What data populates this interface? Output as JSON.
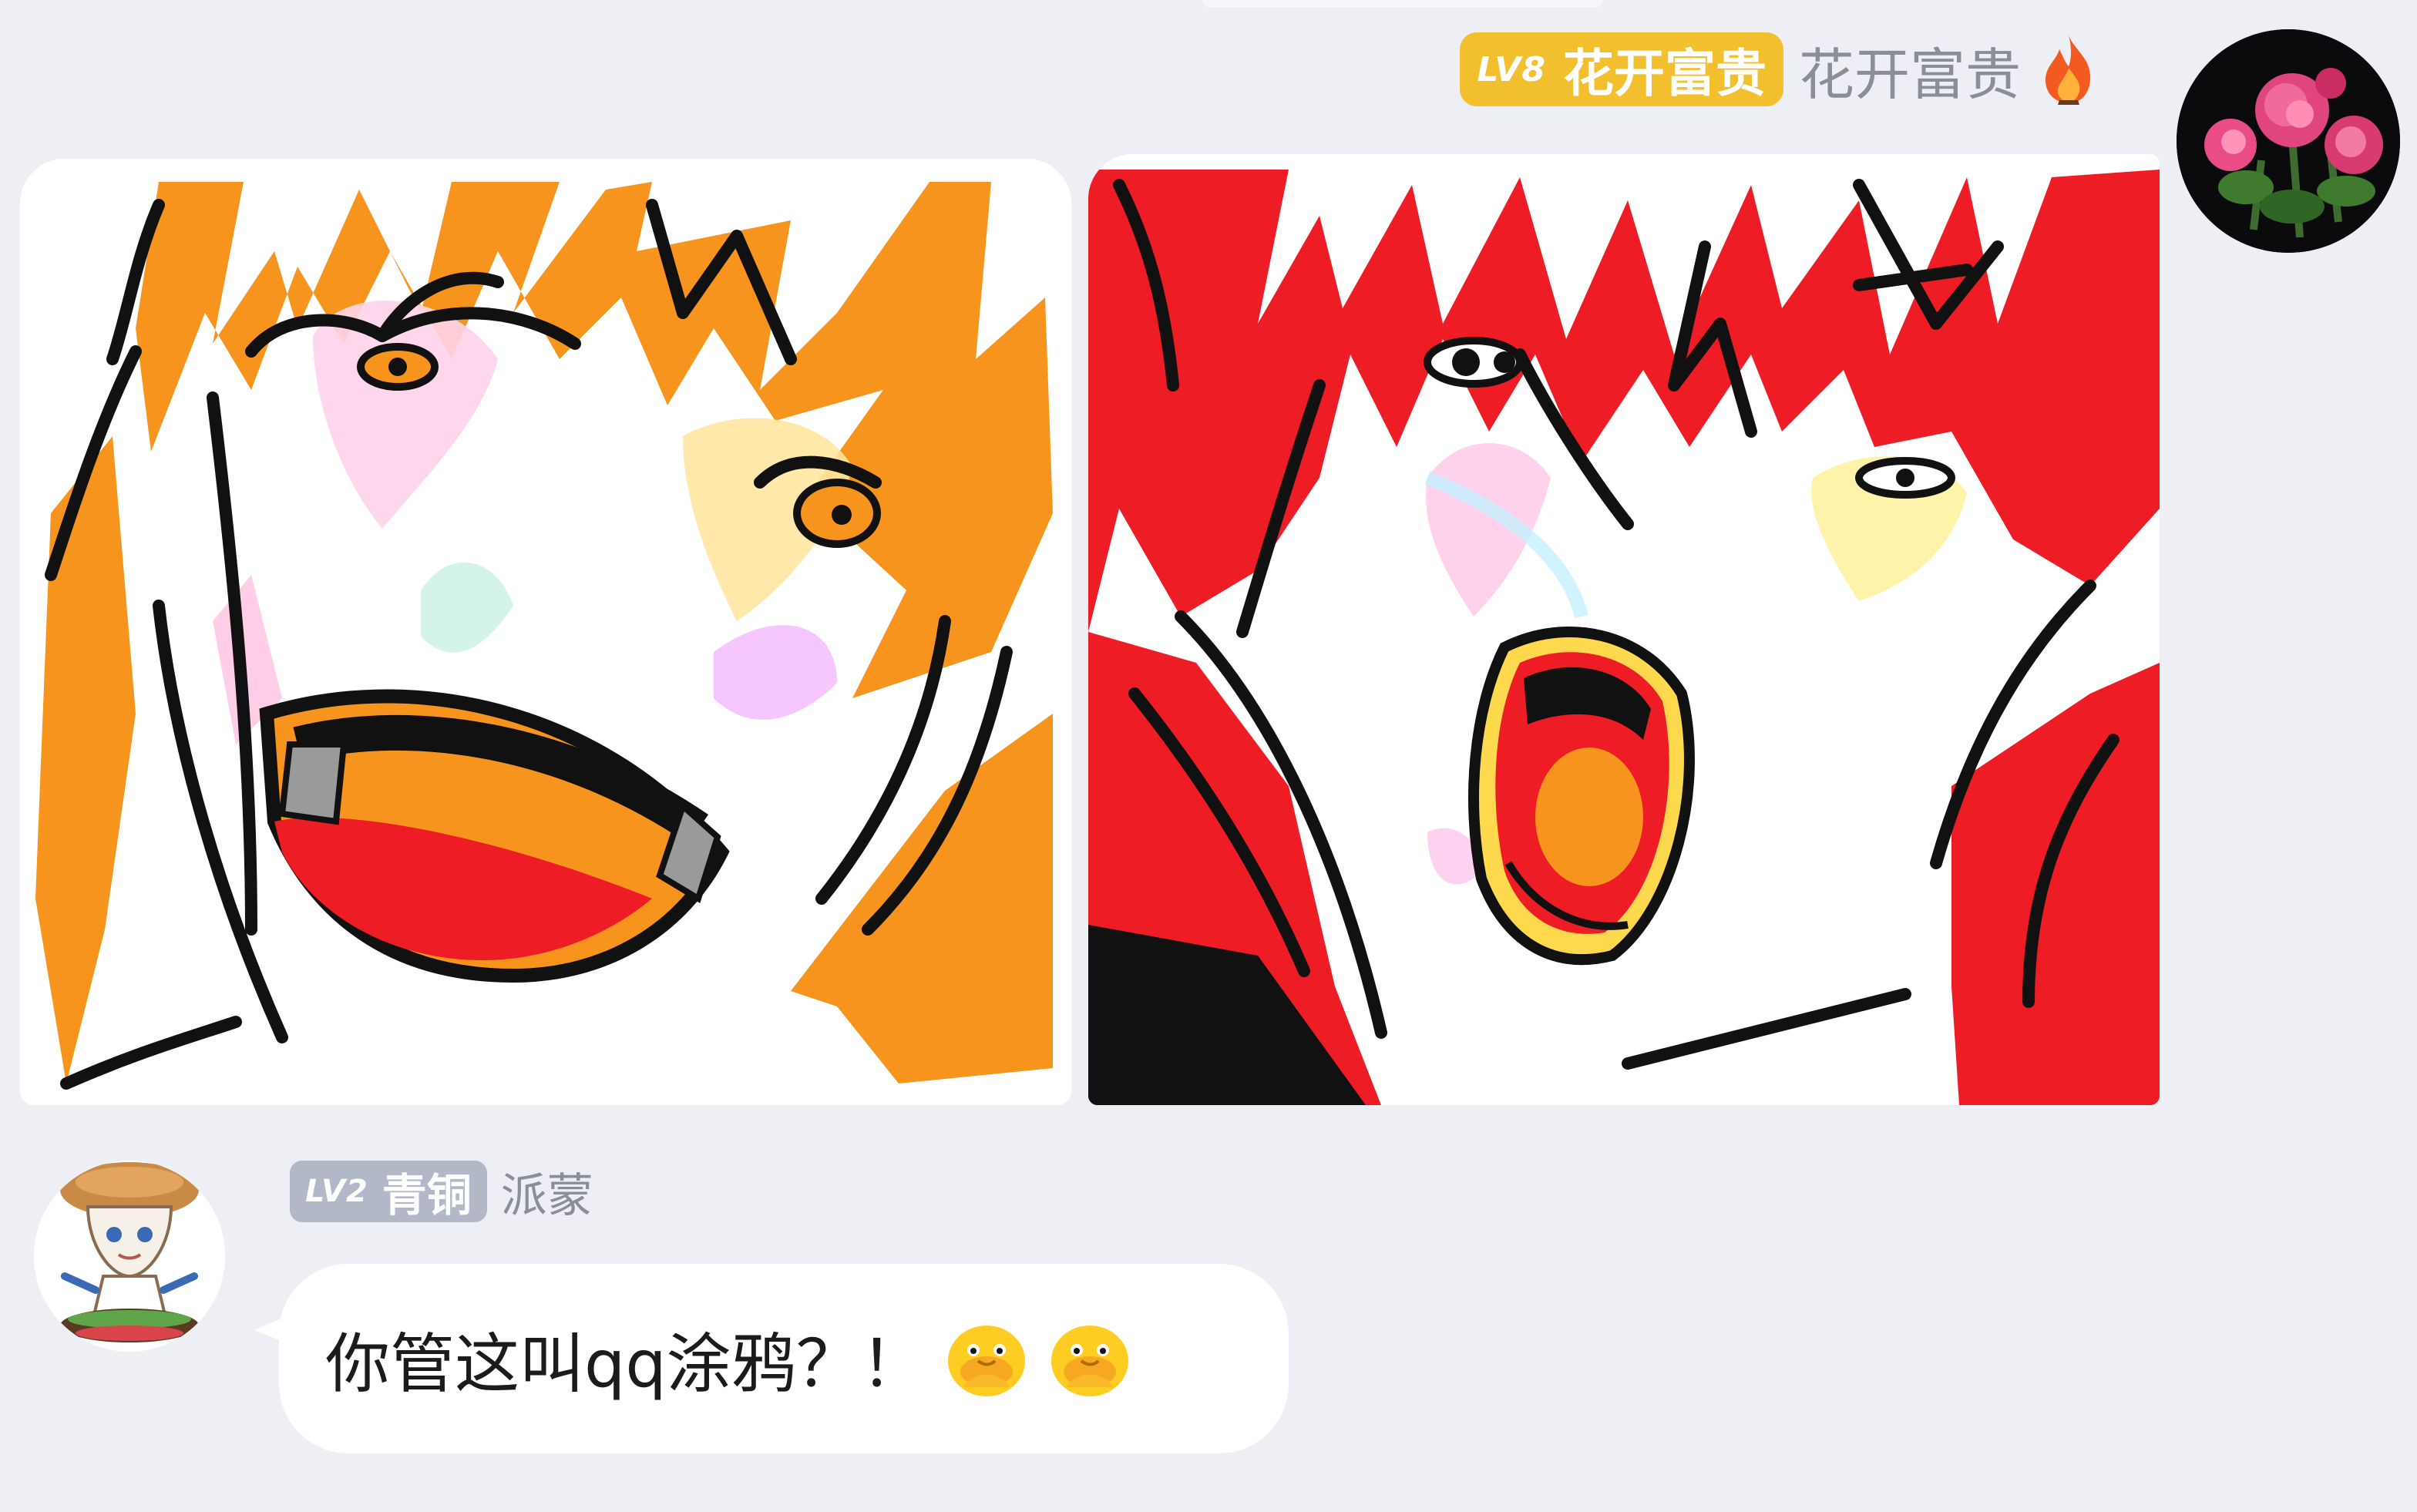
{
  "top_message": {
    "level": "LV8",
    "rank": "花开富贵",
    "nickname": "花开富贵",
    "badge_color": "#f2c02f",
    "icon": "fire-icon",
    "avatar": "peony-flower-avatar",
    "images": [
      {
        "name": "meme-image-orange",
        "icon": "orange-haired-laughing-doodle"
      },
      {
        "name": "meme-image-red",
        "icon": "red-haired-screaming-doodle"
      }
    ]
  },
  "reply_message": {
    "level": "LV2",
    "rank": "青铜",
    "nickname": "派蒙",
    "badge_color": "#b3b8c9",
    "avatar": "paimon-character-avatar",
    "text": "你管这叫qq涂鸦？！",
    "emojis": [
      "cowering-duck-emoji",
      "cowering-duck-emoji"
    ]
  }
}
